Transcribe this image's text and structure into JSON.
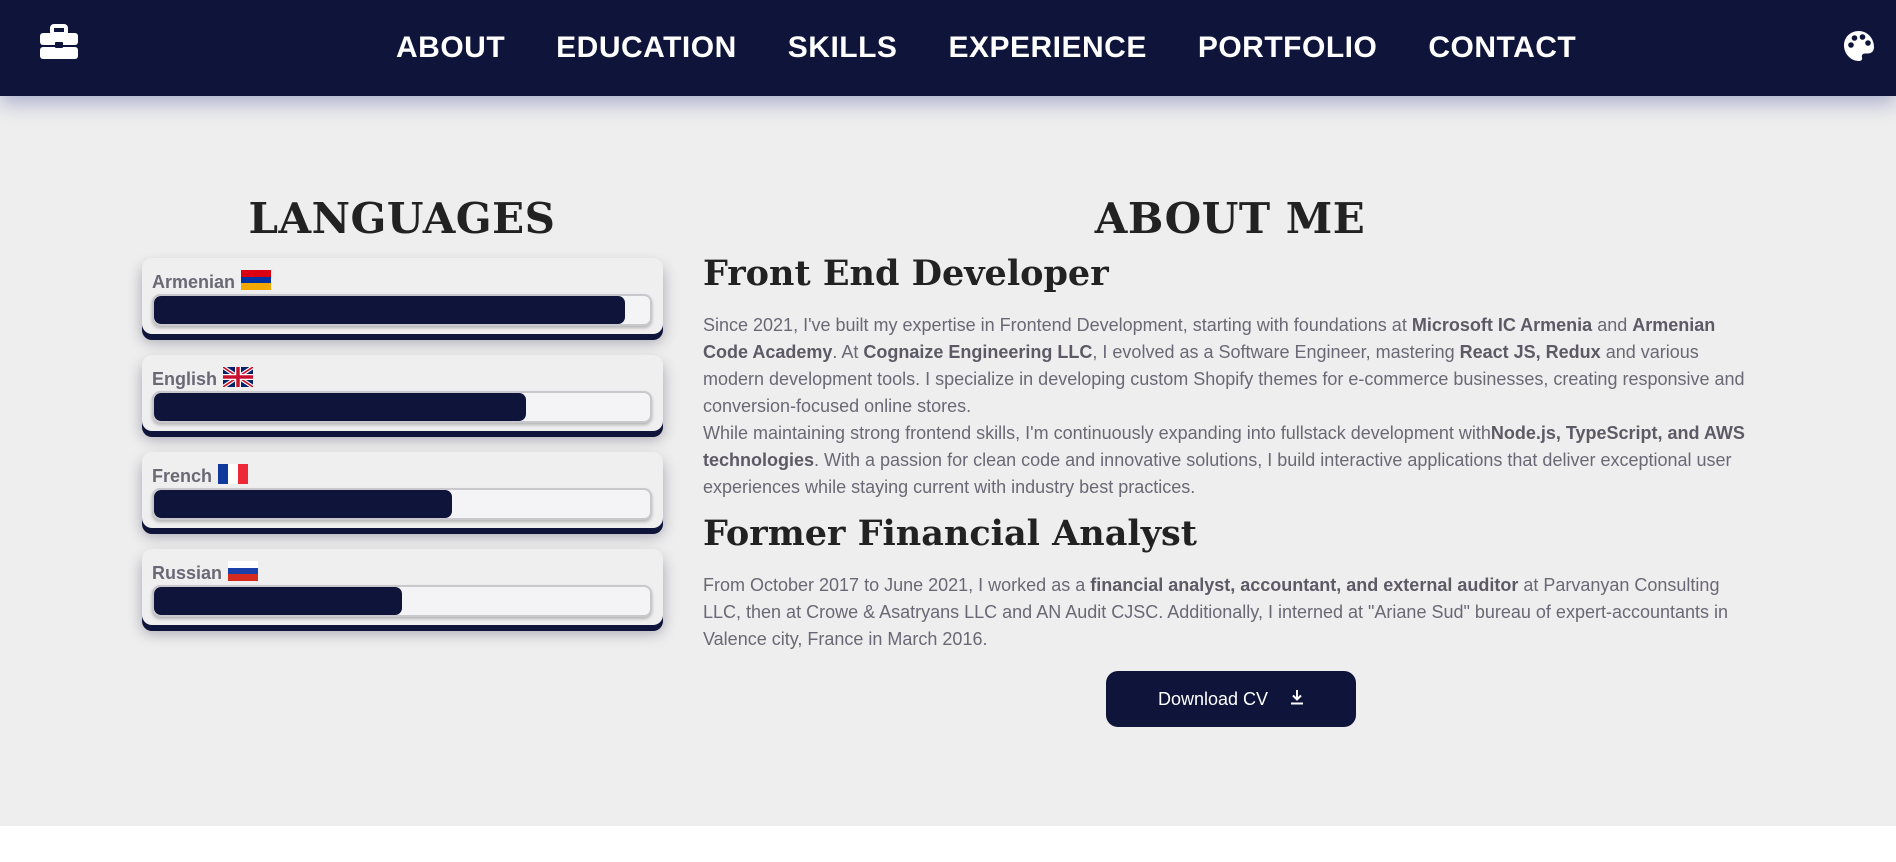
{
  "nav": {
    "logo_icon": "briefcase-icon",
    "theme_icon": "palette-icon",
    "links": [
      "ABOUT",
      "EDUCATION",
      "SKILLS",
      "EXPERIENCE",
      "PORTFOLIO",
      "CONTACT"
    ]
  },
  "languages": {
    "title": "LANGUAGES",
    "items": [
      {
        "name": "Armenian",
        "flag": "armenia-flag-icon",
        "level": 0.95
      },
      {
        "name": "English",
        "flag": "uk-flag-icon",
        "level": 0.75
      },
      {
        "name": "French",
        "flag": "france-flag-icon",
        "level": 0.6
      },
      {
        "name": "Russian",
        "flag": "russia-flag-icon",
        "level": 0.5
      }
    ]
  },
  "about": {
    "title": "ABOUT ME",
    "role1": {
      "title": "Front End Developer",
      "p1": {
        "t1": "Since 2021, I've built my expertise in Frontend Development, starting with foundations at ",
        "b1": "Microsoft IC Armenia",
        "t2": " and ",
        "b2": "Armenian Code Academy",
        "t3": ". At ",
        "b3": "Cognaize Engineering LLC",
        "t4": ", I evolved as a Software Engineer, mastering ",
        "b4": "React JS, Redux",
        "t5": " and various modern development tools. I specialize in developing custom Shopify themes for e-commerce businesses, creating responsive and conversion-focused online stores."
      },
      "p2": {
        "t1": "While maintaining strong frontend skills, I'm continuously expanding into fullstack development with",
        "b1": "Node.js, TypeScript, and AWS technologies",
        "t2": ". With a passion for clean code and innovative solutions, I build interactive applications that deliver exceptional user experiences while staying current with industry best practices."
      }
    },
    "role2": {
      "title": "Former Financial Analyst",
      "p1": {
        "t1": "From October 2017 to June 2021, I worked as a ",
        "b1": "financial analyst, accountant, and external auditor",
        "t2": " at Parvanyan Consulting LLC, then at Crowe & Asatryans LLC and AN Audit CJSC. Additionally, I interned at \"Ariane Sud\" bureau of expert-accountants in Valence city, France in March 2016."
      }
    },
    "download_label": "Download CV",
    "download_icon": "download-icon"
  },
  "colors": {
    "navy": "#0e143a",
    "background": "#eeeeee",
    "text": "#6b6875",
    "heading": "#222222"
  }
}
